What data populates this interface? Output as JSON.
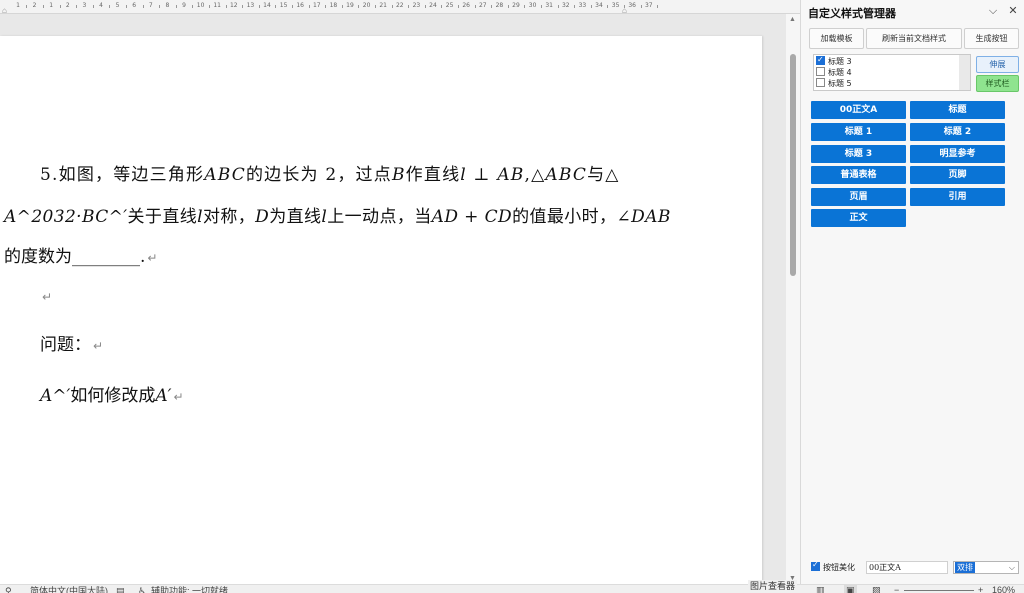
{
  "ruler": {
    "labels": [
      "1",
      "2",
      "1",
      "2",
      "3",
      "4",
      "5",
      "6",
      "7",
      "8",
      "9",
      "10",
      "11",
      "12",
      "13",
      "14",
      "15",
      "16",
      "17",
      "18",
      "19",
      "20",
      "21",
      "22",
      "23",
      "24",
      "25",
      "26",
      "27",
      "28",
      "29",
      "30",
      "31",
      "32",
      "33",
      "34",
      "35",
      "36",
      "37"
    ]
  },
  "document": {
    "line1": {
      "t1": "5.如图，等边三角形",
      "m1": "ABC",
      "t2": "的边长为 2，过点",
      "m2": "B",
      "t3": "作直线",
      "m3": "l ⊥ AB",
      "t4": ",△",
      "m4": "ABC",
      "t5": "与△"
    },
    "line2": {
      "m1": "A^2032·BC^′",
      "t1": "关于直线",
      "m2": "l",
      "t2": "对称，",
      "m3": "D",
      "t3": "为直线",
      "m4": "l",
      "t4": "上一动点，当",
      "m5": "AD + CD",
      "t5": "的值最小时，",
      "m6": "∠DAB"
    },
    "line3": {
      "t1": "的度数为________."
    },
    "question_label": "问题：",
    "question_line": {
      "m1": "A^′",
      "t1": "如何修改成",
      "m2": "A′"
    },
    "para_mark": "↵"
  },
  "panel": {
    "title": "自定义样式管理器",
    "collapse_icon": "chevron-down-icon",
    "close_icon": "close-icon",
    "top_buttons": [
      "加载模板",
      "刷新当前文档样式",
      "生成按钮"
    ],
    "style_list": [
      {
        "label": "标题 3",
        "checked": true
      },
      {
        "label": "标题 4",
        "checked": false
      },
      {
        "label": "标题 5",
        "checked": false
      }
    ],
    "expand_button": "伸展",
    "stylebar_button": "样式栏",
    "style_buttons": [
      "00正文A",
      "标题",
      "标题 1",
      "标题 2",
      "标题 3",
      "明显参考",
      "普通表格",
      "页脚",
      "页眉",
      "引用",
      "正文"
    ],
    "beautify_label": "按钮美化",
    "beautify_checked": true,
    "beautify_value": "00正文A",
    "layout_value": "双排"
  },
  "statusbar": {
    "language": "简体中文(中国大陆)",
    "accessibility": "辅助功能: 一切就绪",
    "image_viewer": "图片查看器",
    "zoom": "160%"
  },
  "colors": {
    "style_button": "#0a74d6",
    "stylebar_button": "#8fe48f",
    "checkbox": "#1b6fd6"
  }
}
